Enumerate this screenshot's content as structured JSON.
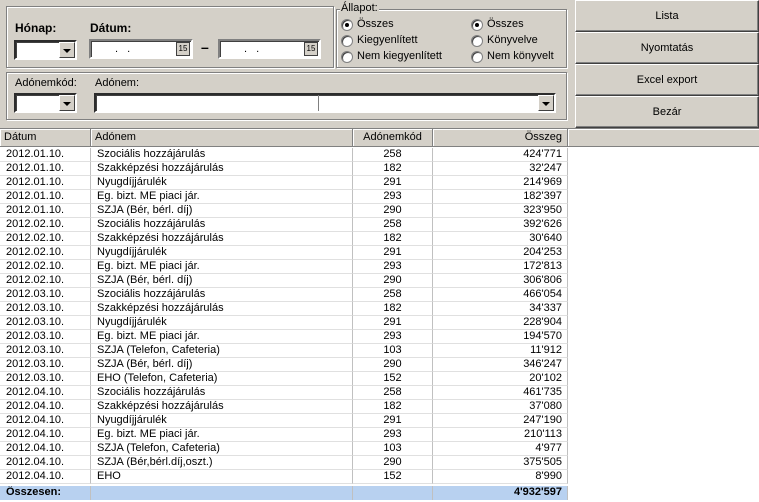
{
  "filters": {
    "honap_label": "Hónap:",
    "honap_value": "",
    "datum_label": "Dátum:",
    "date_from": ". .",
    "date_to": ". .",
    "date_separator": "–",
    "calendar_glyph": "15",
    "allapot_label": "Állapot:",
    "allapot_options": [
      "Összes",
      "Kiegyenlített",
      "Nem kiegyenlített"
    ],
    "allapot_selected": 0,
    "konyv_options": [
      "Összes",
      "Könyvelve",
      "Nem könyvelt"
    ],
    "konyv_selected": 0,
    "adonemkod_label": "Adónemkód:",
    "adonem_label": "Adónem:"
  },
  "buttons": {
    "lista": "Lista",
    "nyomtatas": "Nyomtatás",
    "excel": "Excel export",
    "bezar": "Bezár"
  },
  "table": {
    "headers": [
      "Dátum",
      "Adónem",
      "Adónemkód",
      "Összeg"
    ],
    "rows": [
      [
        "2012.01.10.",
        "Szociális hozzájárulás",
        "258",
        "424'771"
      ],
      [
        "2012.01.10.",
        "Szakképzési hozzájárulás",
        "182",
        "32'247"
      ],
      [
        "2012.01.10.",
        "Nyugdíjjárulék",
        "291",
        "214'969"
      ],
      [
        "2012.01.10.",
        "Eg. bizt. ME piaci jár.",
        "293",
        "182'397"
      ],
      [
        "2012.01.10.",
        "SZJA (Bér, bérl. díj)",
        "290",
        "323'950"
      ],
      [
        "2012.02.10.",
        "Szociális hozzájárulás",
        "258",
        "392'626"
      ],
      [
        "2012.02.10.",
        "Szakképzési hozzájárulás",
        "182",
        "30'640"
      ],
      [
        "2012.02.10.",
        "Nyugdíjjárulék",
        "291",
        "204'253"
      ],
      [
        "2012.02.10.",
        "Eg. bizt. ME piaci jár.",
        "293",
        "172'813"
      ],
      [
        "2012.02.10.",
        "SZJA (Bér, bérl. díj)",
        "290",
        "306'806"
      ],
      [
        "2012.03.10.",
        "Szociális hozzájárulás",
        "258",
        "466'054"
      ],
      [
        "2012.03.10.",
        "Szakképzési hozzájárulás",
        "182",
        "34'337"
      ],
      [
        "2012.03.10.",
        "Nyugdíjjárulék",
        "291",
        "228'904"
      ],
      [
        "2012.03.10.",
        "Eg. bizt. ME piaci jár.",
        "293",
        "194'570"
      ],
      [
        "2012.03.10.",
        "SZJA (Telefon, Cafeteria)",
        "103",
        "11'912"
      ],
      [
        "2012.03.10.",
        "SZJA (Bér, bérl. díj)",
        "290",
        "346'247"
      ],
      [
        "2012.03.10.",
        "EHO (Telefon, Cafeteria)",
        "152",
        "20'102"
      ],
      [
        "2012.04.10.",
        "Szociális hozzájárulás",
        "258",
        "461'735"
      ],
      [
        "2012.04.10.",
        "Szakképzési hozzájárulás",
        "182",
        "37'080"
      ],
      [
        "2012.04.10.",
        "Nyugdíjjárulék",
        "291",
        "247'190"
      ],
      [
        "2012.04.10.",
        "Eg. bizt. ME piaci jár.",
        "293",
        "210'113"
      ],
      [
        "2012.04.10.",
        "SZJA (Telefon, Cafeteria)",
        "103",
        "4'977"
      ],
      [
        "2012.04.10.",
        "SZJA (Bér,bérl.díj,oszt.)",
        "290",
        "375'505"
      ],
      [
        "2012.04.10.",
        "EHO",
        "152",
        "8'990"
      ]
    ],
    "total_label": "Összesen:",
    "total_value": "4'932'597"
  }
}
